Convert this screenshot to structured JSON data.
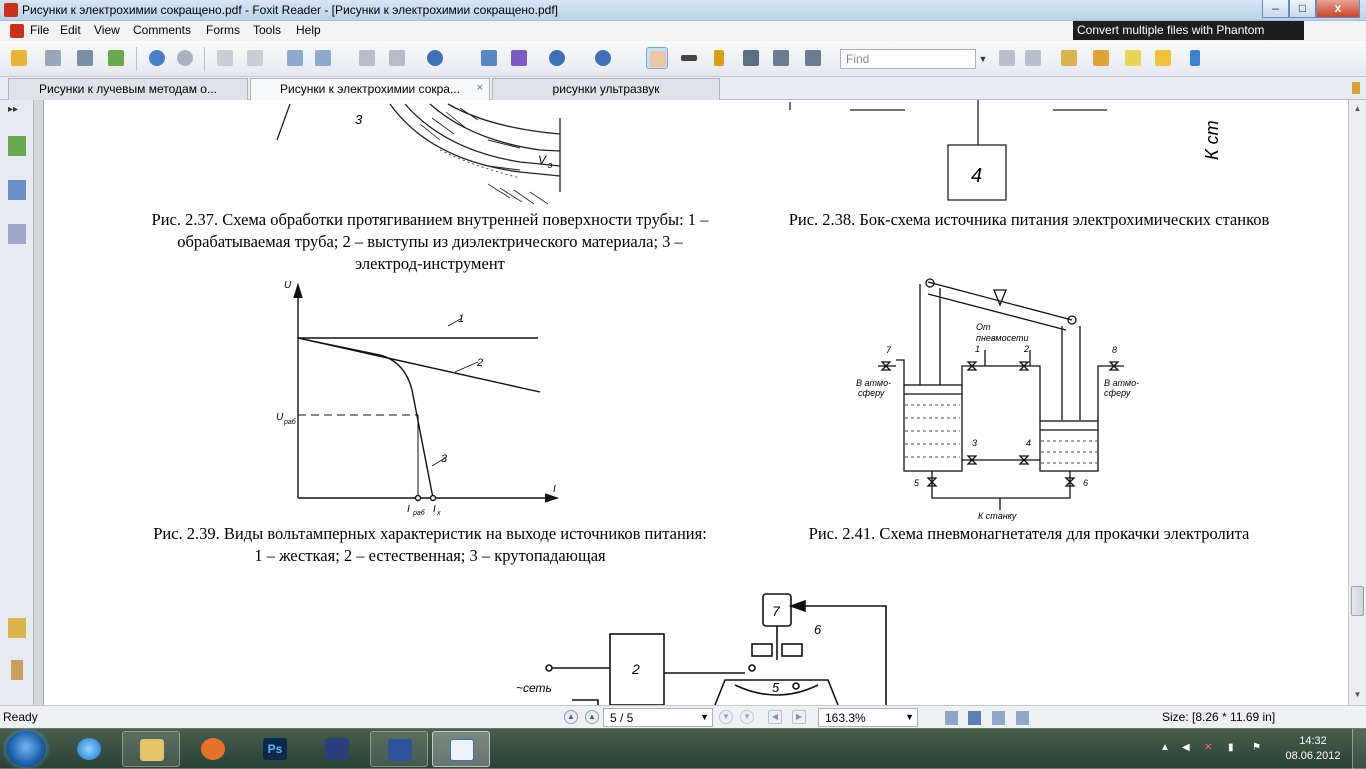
{
  "window": {
    "title": "Рисунки к электрохимии сокращено.pdf - Foxit Reader - [Рисунки к электрохимии сокращено.pdf]",
    "minimize": "–",
    "maximize": "□",
    "close": "x"
  },
  "menu": {
    "items": [
      "File",
      "Edit",
      "View",
      "Comments",
      "Forms",
      "Tools",
      "Help"
    ],
    "ad_banner": "Convert multiple files with Phantom"
  },
  "toolbar": {
    "find_placeholder": "Find"
  },
  "tabs": [
    {
      "label": "Рисунки к лучевым методам о...",
      "active": false
    },
    {
      "label": "Рисунки к электрохимии сокра...",
      "active": true
    },
    {
      "label": "рисунки ультразвук",
      "active": false
    }
  ],
  "tab_close": "×",
  "document": {
    "captions": {
      "fig237": "Рис. 2.37. Схема обработки протягиванием внутренней поверхности трубы:  1 – обрабатываемая труба; 2 – выступы из диэлектрического материала; 3 – электрод-инструмент",
      "fig238": "Рис. 2.38. Бок-схема источника питания электрохимических станков",
      "fig239": "Рис. 2.39. Виды вольтамперных характеристик на выходе источников питания: 1 – жесткая; 2 – естественная; 3 – крутопадающая",
      "fig241": "Рис. 2.41. Схема пневмонагнетателя для прокачки электролита"
    },
    "fig237_labels": {
      "n3": "3",
      "v": "V",
      "vsub": "э"
    },
    "fig238_labels": {
      "block": "4",
      "side": "К ст"
    },
    "fig239_labels": {
      "U": "U",
      "I": "I",
      "Urab": "U",
      "Urab_sub": "раб",
      "Irab": "I",
      "Irab_sub": "раб",
      "Ix": "I",
      "Ix_sub": "х",
      "c1": "1",
      "c2": "2",
      "c3": "3"
    },
    "fig241_labels": {
      "ot": "От",
      "pnevmoseti": "пневмосети",
      "v1": "В атмо-",
      "v1b": "сферу",
      "v2": "В атмо-",
      "v2b": "сферу",
      "k_stanku": "К станку",
      "n1": "1",
      "n2": "2",
      "n3": "3",
      "n4": "4",
      "n5": "5",
      "n6": "6",
      "n7": "7",
      "n8": "8"
    },
    "fig_bottom_labels": {
      "n2": "2",
      "n5": "5",
      "n6": "6",
      "n7": "7",
      "set": "~сеть"
    }
  },
  "status": {
    "ready": "Ready",
    "page": "5 / 5",
    "zoom": "163.3%",
    "size": "Size: [8.26 * 11.69 in]"
  },
  "taskbar": {
    "time": "14:32",
    "date": "08.06.2012",
    "ps_label": "Ps"
  }
}
